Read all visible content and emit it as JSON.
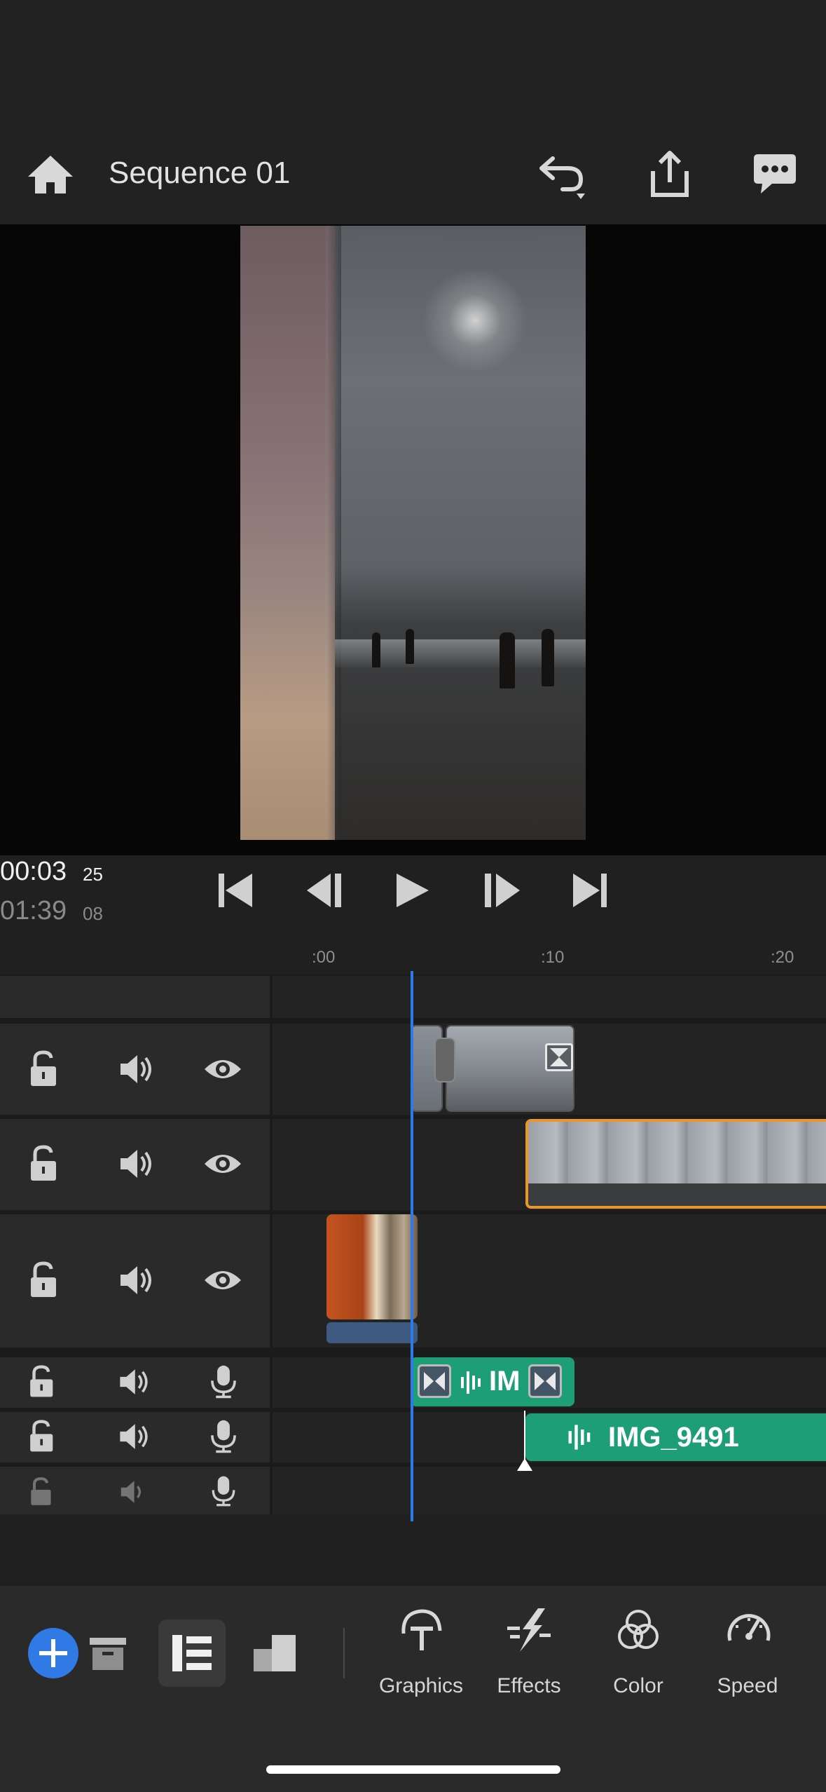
{
  "header": {
    "title": "Sequence 01"
  },
  "timecode": {
    "current_main": "00:03",
    "current_frames": "25",
    "duration_main": "01:39",
    "duration_frames": "08"
  },
  "ruler": {
    "labels": [
      ":00",
      ":10",
      ":20"
    ]
  },
  "audio_clips": {
    "clip1_label": "IM",
    "clip2_label": "IMG_9491"
  },
  "toolbar": {
    "tools": [
      {
        "label": "Graphics",
        "icon": "graphics-icon"
      },
      {
        "label": "Effects",
        "icon": "effects-icon"
      },
      {
        "label": "Color",
        "icon": "color-icon"
      },
      {
        "label": "Speed",
        "icon": "speed-icon"
      }
    ]
  },
  "colors": {
    "accent_blue": "#2f7ae5",
    "selection_orange": "#e8962e",
    "audio_green": "#1e9e74"
  }
}
